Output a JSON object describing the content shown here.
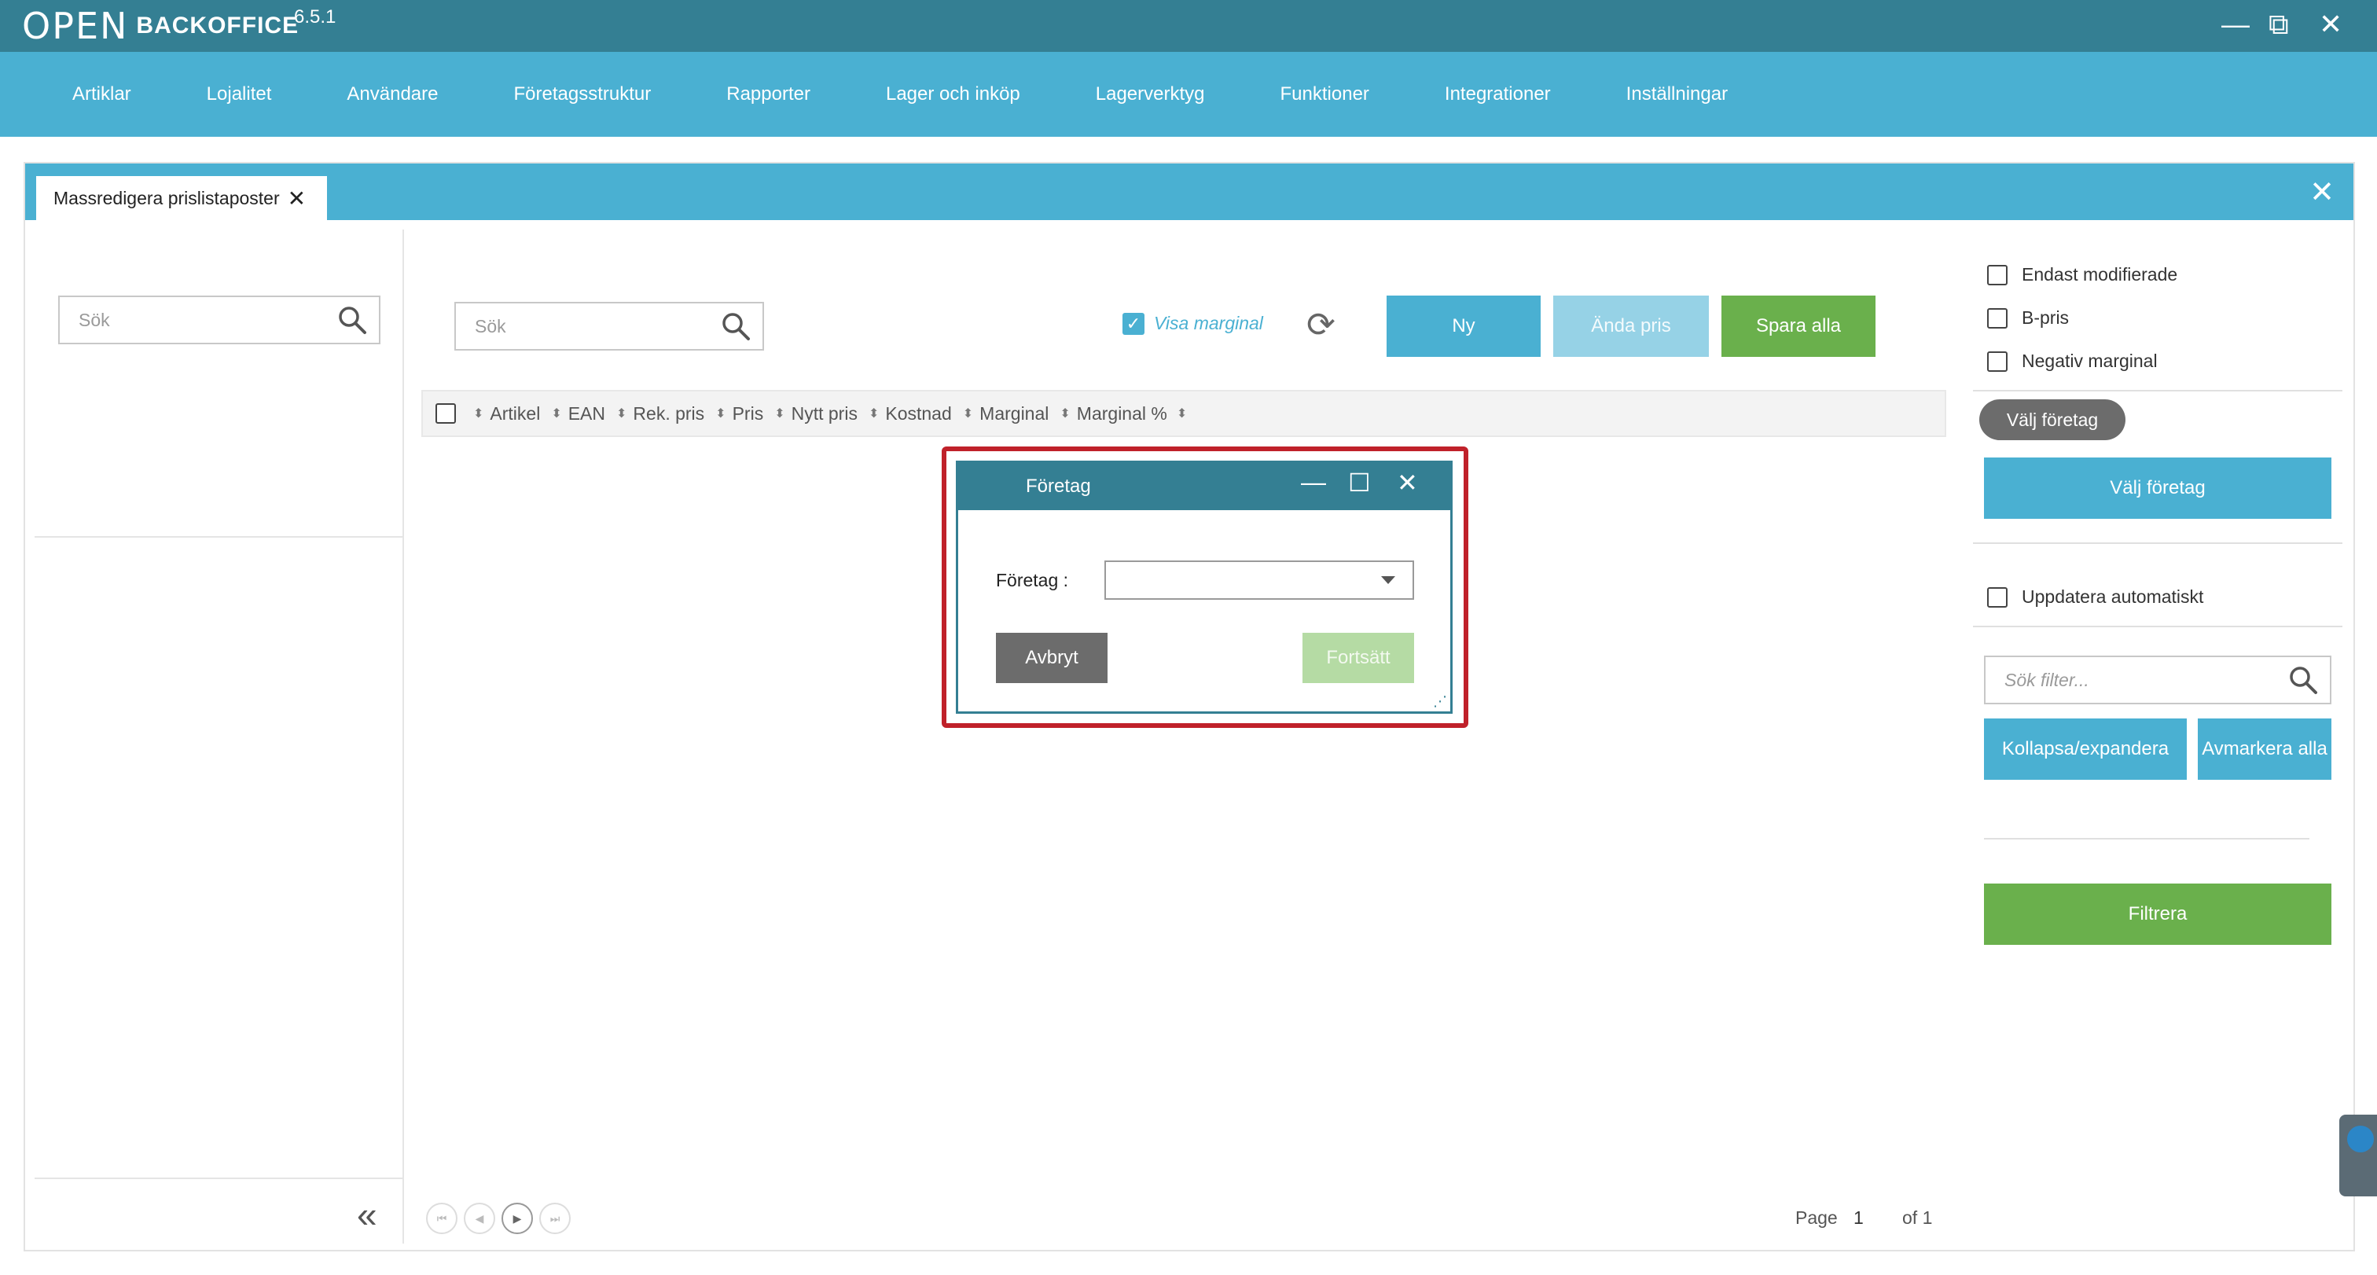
{
  "app": {
    "logo_mark": "OPEN",
    "logo_text": "BACKOFFICE",
    "version": "6.5.1"
  },
  "window_controls": {
    "minimize": "—",
    "restore": "⧉",
    "close": "✕"
  },
  "nav": {
    "items": [
      "Artiklar",
      "Lojalitet",
      "Användare",
      "Företagsstruktur",
      "Rapporter",
      "Lager och inköp",
      "Lagerverktyg",
      "Funktioner",
      "Integrationer",
      "Inställningar"
    ]
  },
  "tab": {
    "label": "Massredigera prislistaposter",
    "close": "✕"
  },
  "panel_close": "✕",
  "left_search": {
    "placeholder": "Sök"
  },
  "main_search": {
    "placeholder": "Sök"
  },
  "toolbar": {
    "visa_marginal_label": "Visa marginal",
    "visa_marginal_checked": true,
    "ny_label": "Ny",
    "andra_pris_label": "Ända pris",
    "spara_alla_label": "Spara alla"
  },
  "table": {
    "columns": [
      "Artikel",
      "EAN",
      "Rek. pris",
      "Pris",
      "Nytt pris",
      "Kostnad",
      "Marginal",
      "Marginal %"
    ]
  },
  "pager": {
    "page_label": "Page",
    "page_number": "1",
    "of_label": "of 1"
  },
  "right_panel": {
    "checkboxes": [
      {
        "label": "Endast modifierade",
        "checked": false
      },
      {
        "label": "B-pris",
        "checked": false
      },
      {
        "label": "Negativ marginal",
        "checked": false
      }
    ],
    "pill_label": "Välj företag",
    "valj_foretag_button": "Välj företag",
    "auto_update": {
      "label": "Uppdatera automatiskt",
      "checked": false
    },
    "filter_search": {
      "placeholder": "Sök filter..."
    },
    "kollapsa_button": "Kollapsa/expandera",
    "avmarkera_button": "Avmarkera alla",
    "filtrera_button": "Filtrera"
  },
  "dialog": {
    "title": "Företag",
    "field_label": "Företag :",
    "field_value": "",
    "cancel_label": "Avbryt",
    "continue_label": "Fortsätt"
  },
  "colors": {
    "titlebar": "#347f93",
    "navbar": "#4ab0d2",
    "primary_button": "#4ab0d2",
    "disabled_button": "#96d2e6",
    "green_button": "#6ab04c",
    "disabled_green": "#b5dba4",
    "gray_button": "#6c6c6c",
    "highlight": "#c0212a"
  }
}
